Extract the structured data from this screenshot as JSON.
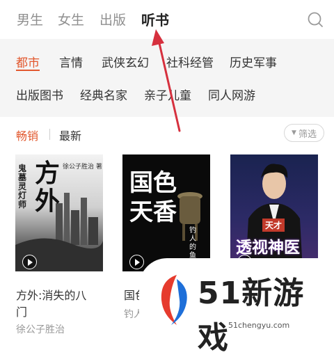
{
  "top_tabs": [
    "男生",
    "女生",
    "出版",
    "听书"
  ],
  "active_tab": "听书",
  "categories_row1": [
    "都市",
    "言情",
    "武侠玄幻",
    "社科经管",
    "历史军事"
  ],
  "categories_row2": [
    "出版图书",
    "经典名家",
    "亲子儿童",
    "同人网游"
  ],
  "active_category": "都市",
  "sort": {
    "hot": "畅销",
    "new": "最新",
    "filter": "筛选"
  },
  "books": [
    {
      "title_line1": "方外:消失的八",
      "title_line2": "门",
      "author": "徐公子胜治",
      "cover_art": {
        "vertical_text": "鬼墓灵灯师",
        "big": "方外",
        "small": "徐公子胜治 著"
      }
    },
    {
      "title_line1": "国色",
      "author": "钓人",
      "cover_art": {
        "big": "国色天香",
        "small": "钓人的鱼"
      }
    },
    {
      "title_line1": "",
      "author": "",
      "cover_art": {
        "tag": "天才",
        "big": "透视神医"
      }
    }
  ],
  "watermark": {
    "text": "51新游戏",
    "url": "51chengyu.com"
  },
  "colors": {
    "accent": "#e2582e",
    "arrow": "#d6303e"
  }
}
